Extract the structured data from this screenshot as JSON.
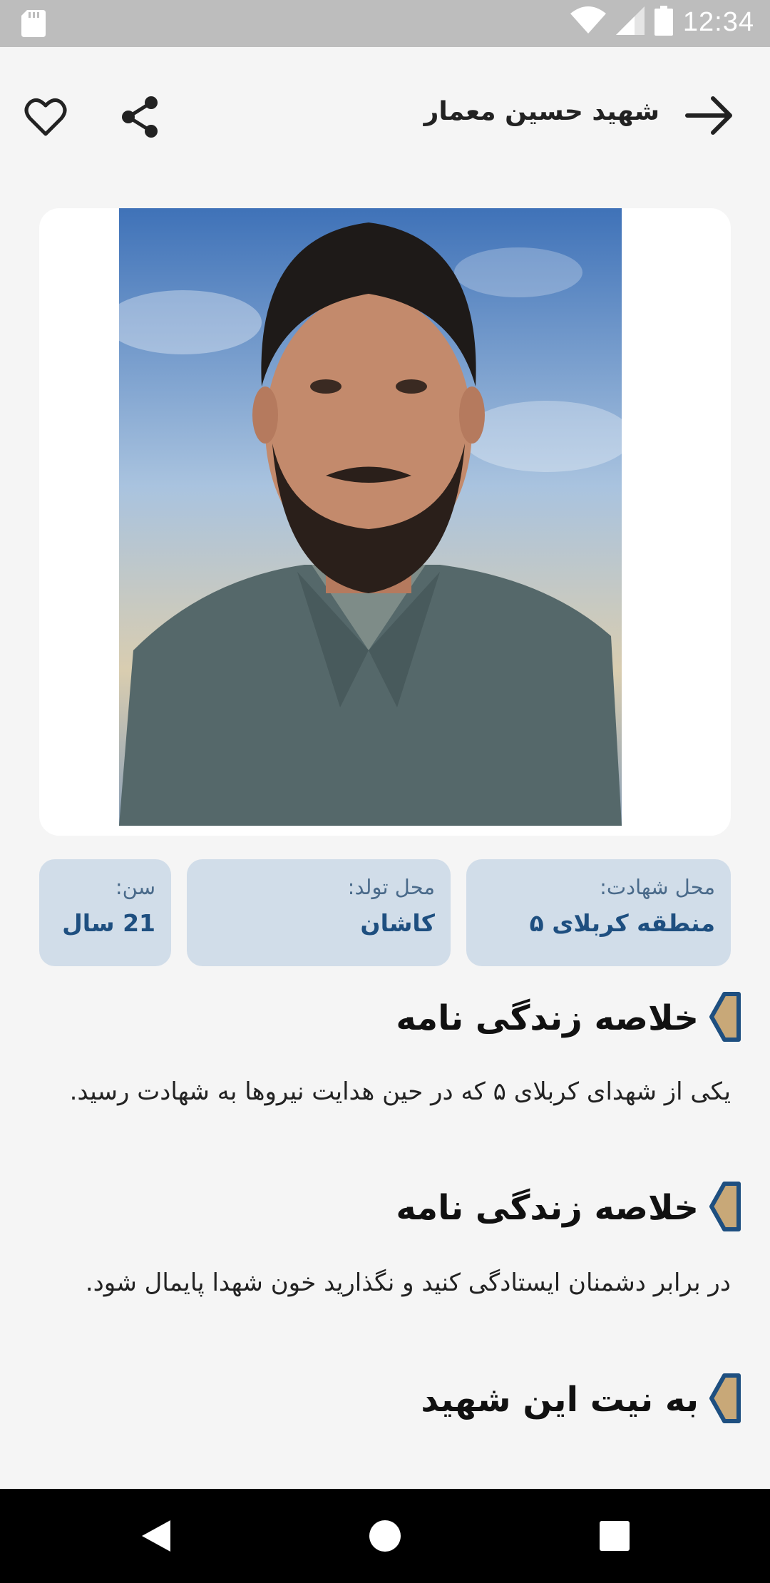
{
  "status_bar": {
    "time": "12:34",
    "icons": [
      "sd-card-icon",
      "wifi-icon",
      "signal-icon",
      "battery-icon"
    ]
  },
  "header": {
    "title": "شهید حسین معمار",
    "icons": [
      "back-arrow-icon",
      "share-icon",
      "heart-icon"
    ]
  },
  "info": {
    "place_of_martyrdom": {
      "label": "محل شهادت:",
      "value": "منطقه کربلای ۵"
    },
    "place_of_birth": {
      "label": "محل تولد:",
      "value": "کاشان"
    },
    "age": {
      "label": "سن:",
      "value": "21 سال"
    }
  },
  "sections": [
    {
      "title": "خلاصه زندگی نامه",
      "text": "یکی از شهدای کربلای ۵ که در حین هدایت نیروها به شهادت رسید."
    },
    {
      "title": "خلاصه زندگی نامه",
      "text": "در برابر دشمنان ایستادگی کنید و نگذارید خون شهدا پایمال شود."
    },
    {
      "title": "به نیت این شهید"
    }
  ],
  "colors": {
    "info_card_bg": "#d1dde9",
    "info_value": "#1e4f80",
    "section_marker_fill": "#c8a878",
    "section_marker_stroke": "#1e4f80"
  },
  "nav_bar": {
    "icons": [
      "back-triangle-icon",
      "home-circle-icon",
      "recents-square-icon"
    ]
  }
}
